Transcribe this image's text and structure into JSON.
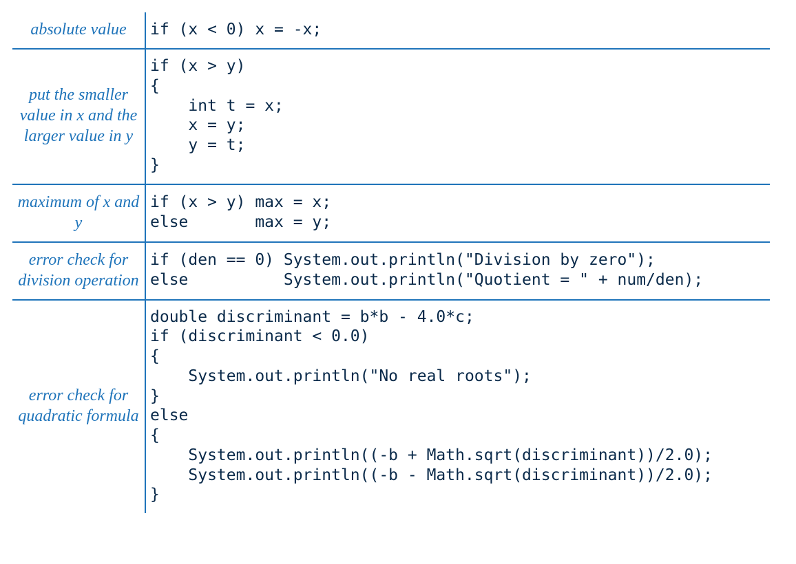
{
  "rows": [
    {
      "label": "absolute value",
      "code": "if (x < 0) x = -x;"
    },
    {
      "label": "put the smaller\nvalue in x\nand the larger\nvalue in y",
      "code": "if (x > y)\n{\n    int t = x;\n    x = y;\n    y = t;\n}"
    },
    {
      "label": "maximum of\nx and y",
      "code": "if (x > y) max = x;\nelse       max = y;"
    },
    {
      "label": "error check\nfor division\noperation",
      "code": "if (den == 0) System.out.println(\"Division by zero\");\nelse          System.out.println(\"Quotient = \" + num/den);"
    },
    {
      "label": "error check\nfor quadratic\nformula",
      "code": "double discriminant = b*b - 4.0*c;\nif (discriminant < 0.0)\n{\n    System.out.println(\"No real roots\");\n}\nelse\n{\n    System.out.println((-b + Math.sqrt(discriminant))/2.0);\n    System.out.println((-b - Math.sqrt(discriminant))/2.0);\n}"
    }
  ]
}
